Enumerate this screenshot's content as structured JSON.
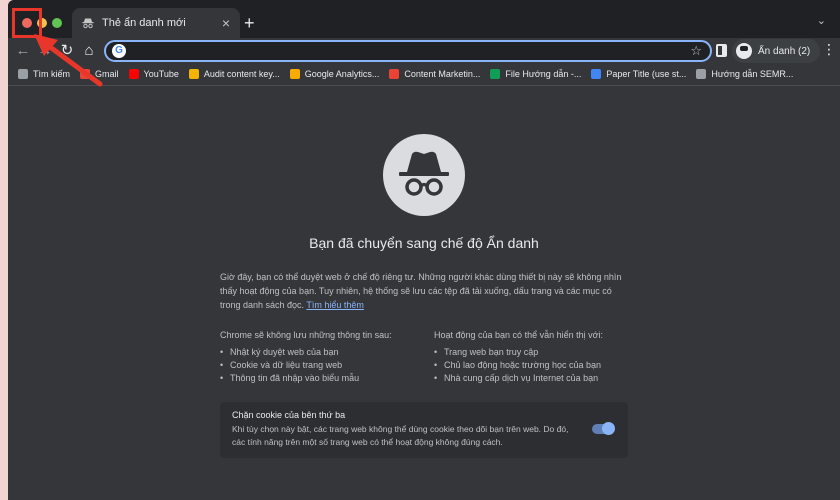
{
  "colors": {
    "accent": "#8ab4f8",
    "annotation": "#e8362a",
    "background": "#35363a",
    "frame": "#202124"
  },
  "tab": {
    "title": "Thẻ ẩn danh mới",
    "close_icon": "close-icon",
    "new_tab_label": "+",
    "list_label": "⌄"
  },
  "toolbar": {
    "back_label": "←",
    "forward_label": "→",
    "reload_label": "↻",
    "home_label": "⌂",
    "omnibox_value": "",
    "star_label": "☆",
    "profile_label": "Ẩn danh (2)",
    "menu_label": "⋮"
  },
  "bookmarks": [
    {
      "label": "Tìm kiếm",
      "color": "#9aa0a6"
    },
    {
      "label": "Gmail",
      "color": "#ea4335"
    },
    {
      "label": "YouTube",
      "color": "#ff0000"
    },
    {
      "label": "Audit content key...",
      "color": "#f4b400"
    },
    {
      "label": "Google Analytics...",
      "color": "#f9ab00"
    },
    {
      "label": "Content Marketin...",
      "color": "#ea4335"
    },
    {
      "label": "File Hướng dẫn -...",
      "color": "#0f9d58"
    },
    {
      "label": "Paper Title (use st...",
      "color": "#4285f4"
    },
    {
      "label": "Hướng dẫn SEMR...",
      "color": "#9aa0a6"
    }
  ],
  "content": {
    "heading": "Bạn đã chuyển sang chế độ Ẩn danh",
    "intro": "Giờ đây, bạn có thể duyệt web ở chế độ riêng tư. Những người khác dùng thiết bị này sẽ không nhìn thấy hoạt động của bạn. Tuy nhiên, hệ thống sẽ lưu các tệp đã tải xuống, dấu trang và các mục có trong danh sách đọc.",
    "learn_more": "Tìm hiểu thêm",
    "left_title": "Chrome sẽ không lưu những thông tin sau:",
    "left_items": [
      "Nhật ký duyệt web của bạn",
      "Cookie và dữ liệu trang web",
      "Thông tin đã nhập vào biểu mẫu"
    ],
    "right_title": "Hoạt động của bạn có thể vẫn hiển thị với:",
    "right_items": [
      "Trang web bạn truy cập",
      "Chủ lao động hoặc trường học của bạn",
      "Nhà cung cấp dịch vụ Internet của bạn"
    ],
    "cookie_title": "Chặn cookie của bên thứ ba",
    "cookie_desc": "Khi tùy chọn này bật, các trang web không thể dùng cookie theo dõi bạn trên web. Do đó, các tính năng trên một số trang web có thể hoạt động không đúng cách.",
    "cookie_toggle_on": true
  }
}
